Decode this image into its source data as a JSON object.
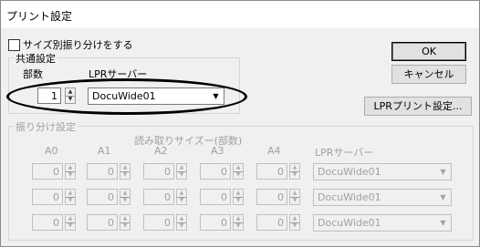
{
  "window": {
    "title": "プリント設定"
  },
  "size_sort": {
    "checkbox_label": "サイズ別振り分けをする",
    "checked": false
  },
  "common": {
    "group_label": "共通設定",
    "copies_label": "部数",
    "server_label": "LPRサーバー",
    "copies_value": "1",
    "server_value": "DocuWide01"
  },
  "buttons": {
    "ok": "OK",
    "cancel": "キャンセル",
    "lpr_settings": "LPRプリント設定..."
  },
  "sort": {
    "group_label": "振り分け設定",
    "read_size_label": "読み取りサイズー(部数)",
    "columns": [
      "A0",
      "A1",
      "A2",
      "A3",
      "A4"
    ],
    "server_column": "LPRサーバー",
    "rows": [
      {
        "values": [
          "0",
          "0",
          "0",
          "0",
          "0"
        ],
        "server": "DocuWide01"
      },
      {
        "values": [
          "0",
          "0",
          "0",
          "0",
          "0"
        ],
        "server": "DocuWide01"
      },
      {
        "values": [
          "0",
          "0",
          "0",
          "0",
          "0"
        ],
        "server": "DocuWide01"
      }
    ]
  },
  "icons": {
    "dropdown": "chevron-down-icon",
    "spin_up": "triangle-up-icon",
    "spin_down": "triangle-down-icon"
  }
}
